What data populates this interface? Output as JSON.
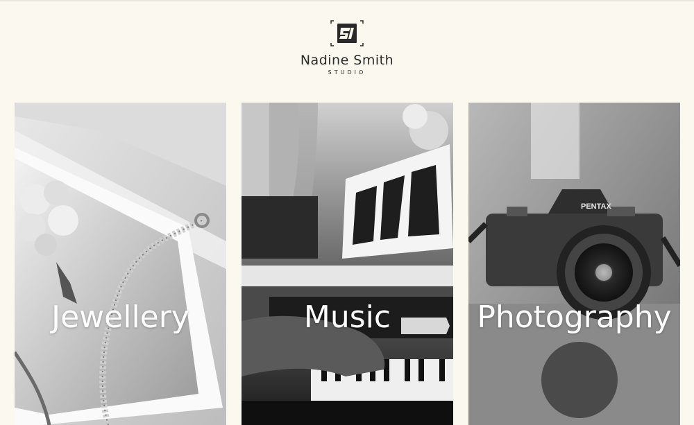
{
  "header": {
    "logo_monogram": "SI",
    "logo_name": "Nadine Smith",
    "logo_sub": "STUDIO"
  },
  "cards": [
    {
      "label": "Jewellery",
      "image": "bride-bouquet-bracelet-photo"
    },
    {
      "label": "Music",
      "image": "piano-hands-sheet-stand-photo"
    },
    {
      "label": "Photography",
      "image": "pentax-camera-photo",
      "camera_brand": "PENTAX"
    }
  ],
  "colors": {
    "background": "#fbf8ef",
    "label_text": "#ffffff",
    "logo_text": "#2a2a2a"
  }
}
